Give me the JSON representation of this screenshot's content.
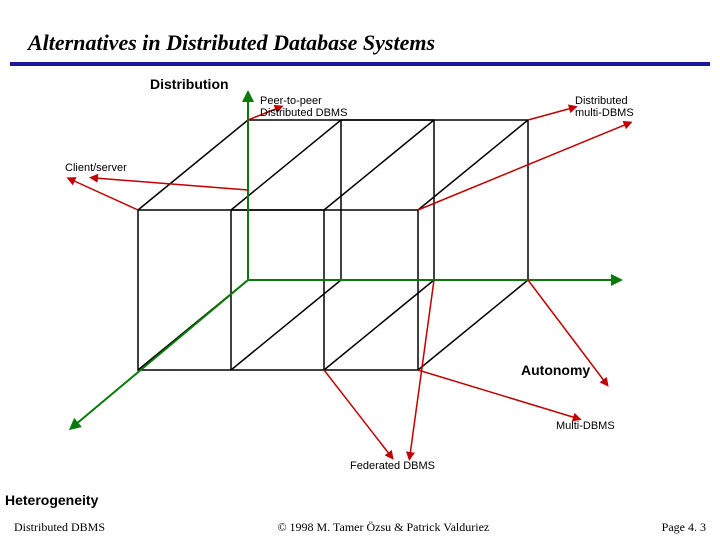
{
  "slide": {
    "title": "Alternatives in Distributed Database Systems",
    "axes": {
      "distribution_label": "Distribution",
      "autonomy_label": "Autonomy",
      "heterogeneity_label": "Heterogeneity"
    },
    "points": {
      "peer_to_peer": "Peer-to-peer\nDistributed DBMS",
      "distributed_multi": "Distributed\nmulti-DBMS",
      "client_server": "Client/server",
      "multi_dbms": "Multi-DBMS",
      "federated_dbms": "Federated DBMS"
    }
  },
  "footer": {
    "left": "Distributed DBMS",
    "center": "© 1998 M. Tamer Özsu & Patrick Valduriez",
    "right": "Page 4. 3"
  }
}
